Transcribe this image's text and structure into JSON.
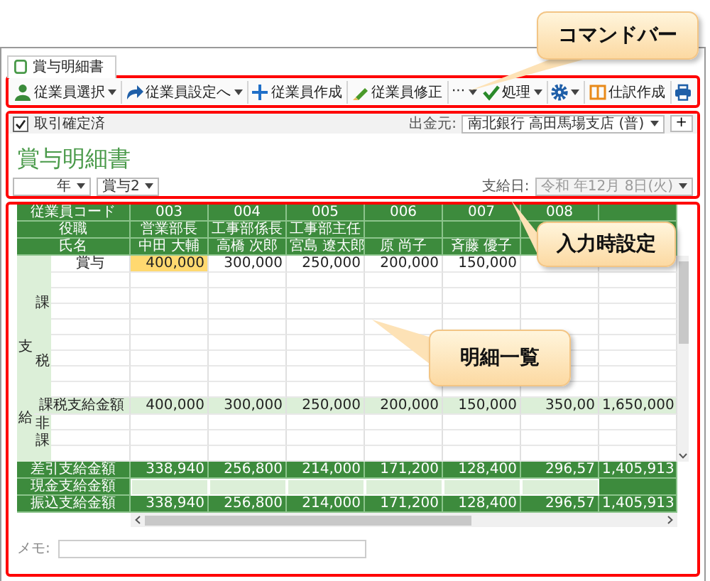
{
  "tab": {
    "label": "賞与明細書",
    "selected": true
  },
  "command_bar": {
    "left": [
      {
        "kind": "menu",
        "label": "従業員選択"
      },
      {
        "kind": "menu",
        "label": "従業員設定へ"
      },
      {
        "kind": "button",
        "label": "従業員作成"
      },
      {
        "kind": "button",
        "label": "従業員修正"
      },
      {
        "kind": "menu",
        "label": "···"
      }
    ],
    "right": [
      {
        "kind": "menu",
        "label": "処理"
      },
      {
        "kind": "menu"
      },
      {
        "kind": "button",
        "label": "仕訳作成"
      },
      {
        "kind": "button"
      }
    ]
  },
  "settings": {
    "confirmed": {
      "label": "取引確定済",
      "checked": true
    },
    "source": {
      "label": "出金元:",
      "value": "南北銀行 高田馬場支店 (普)",
      "add": "+"
    },
    "title": "賞与明細書",
    "year": "年",
    "bonus": "賞与2",
    "pay_date": {
      "label": "支給日:",
      "value": "令和 年12月 8日(火)",
      "disabled": true
    }
  },
  "table": {
    "header": [
      {
        "label": "従業員コード",
        "cells": [
          "003",
          "004",
          "005",
          "006",
          "007",
          "008"
        ]
      },
      {
        "label": "役職",
        "cells": [
          "営業部長",
          "工事部係長",
          "工事部主任"
        ]
      },
      {
        "label": "氏名",
        "cells": [
          "中田 大輔",
          "高橋 次郎",
          "宮島 遼太郎",
          "原 尚子",
          "斉藤 優子"
        ]
      }
    ],
    "group": "支給",
    "taxable": {
      "label": "課税",
      "rows": [
        {
          "label": "賞与",
          "cells": [
            {
              "value": "400,000",
              "selected": true
            },
            {
              "value": "300,000",
              "selected": false
            },
            {
              "value": "250,000",
              "selected": false
            },
            {
              "value": "200,000",
              "selected": false
            },
            {
              "value": "150,000",
              "selected": false
            }
          ]
        }
      ],
      "total": {
        "label": "課税支給金額",
        "cells": [
          "400,000",
          "300,000",
          "250,000",
          "200,000",
          "150,000",
          "350,00",
          "1,650,000"
        ]
      }
    },
    "non_taxable": {
      "label": "非課"
    },
    "footer": [
      {
        "kind": "amount",
        "label": "差引支給金額",
        "cells": [
          "338,940",
          "256,800",
          "214,000",
          "171,200",
          "128,400",
          "296,57",
          "1,405,913"
        ]
      },
      {
        "kind": "input",
        "label": "現金支給金額"
      },
      {
        "kind": "amount",
        "label": "振込支給金額",
        "cells": [
          "338,940",
          "256,800",
          "214,000",
          "171,200",
          "128,400",
          "296,57",
          "1,405,913"
        ]
      }
    ]
  },
  "memo": {
    "label": "メモ:"
  },
  "callouts": [
    {
      "text": "コマンドバー"
    },
    {
      "text": "入力時設定"
    },
    {
      "text": "明細一覧"
    }
  ]
}
